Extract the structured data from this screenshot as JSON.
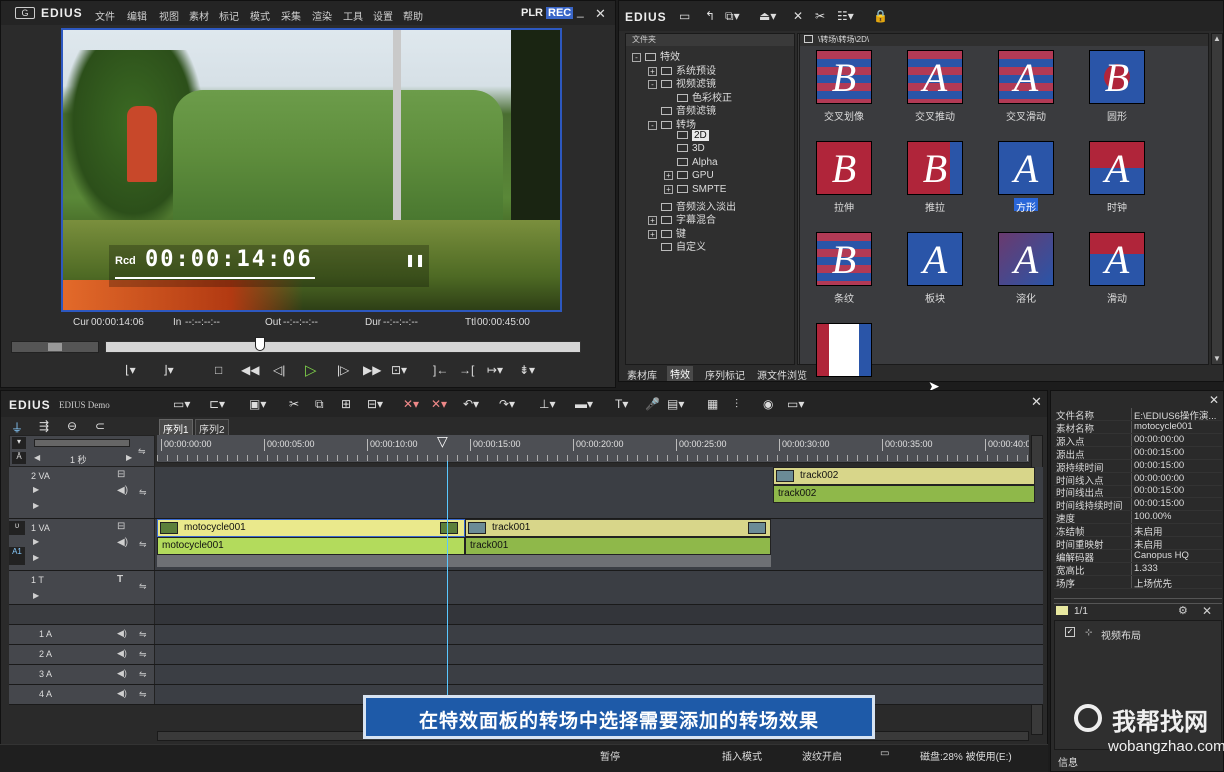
{
  "player": {
    "brand": "EDIUS",
    "menu": [
      "文件",
      "编辑",
      "视图",
      "素材",
      "标记",
      "模式",
      "采集",
      "渲染",
      "工具",
      "设置",
      "帮助"
    ],
    "plr": "PLR",
    "rec": "REC",
    "osd_label": "Rcd",
    "osd_timecode": "00:00:14:06",
    "cur_label": "Cur",
    "cur_value": "00:00:14:06",
    "in_label": "In",
    "in_value": "--:--:--:--",
    "out_label": "Out",
    "out_value": "--:--:--:--",
    "dur_label": "Dur",
    "dur_value": "--:--:--:--",
    "ttl_label": "Ttl",
    "ttl_value": "00:00:45:00",
    "scrub_position": 0.32
  },
  "effects": {
    "brand": "EDIUS",
    "tree_header": "文件夹",
    "path": "\\转场\\转场\\2D\\",
    "tree": [
      {
        "label": "特效",
        "level": 0,
        "expander": "-"
      },
      {
        "label": "系统预设",
        "level": 1,
        "expander": "+"
      },
      {
        "label": "视频滤镜",
        "level": 1,
        "expander": "-"
      },
      {
        "label": "色彩校正",
        "level": 2,
        "expander": ""
      },
      {
        "label": "音频滤镜",
        "level": 1,
        "expander": ""
      },
      {
        "label": "转场",
        "level": 1,
        "expander": "-"
      },
      {
        "label": "2D",
        "level": 2,
        "expander": "",
        "selected": true
      },
      {
        "label": "3D",
        "level": 2,
        "expander": ""
      },
      {
        "label": "Alpha",
        "level": 2,
        "expander": ""
      },
      {
        "label": "GPU",
        "level": 2,
        "expander": "+"
      },
      {
        "label": "SMPTE",
        "level": 2,
        "expander": "+"
      },
      {
        "label": "音频淡入淡出",
        "level": 1,
        "expander": ""
      },
      {
        "label": "字幕混合",
        "level": 1,
        "expander": "+"
      },
      {
        "label": "键",
        "level": 1,
        "expander": "+"
      },
      {
        "label": "自定义",
        "level": 1,
        "expander": ""
      }
    ],
    "items": [
      {
        "label": "交叉划像",
        "letter": "B",
        "style": "stripes"
      },
      {
        "label": "交叉推动",
        "letter": "A",
        "style": "stripes"
      },
      {
        "label": "交叉滑动",
        "letter": "A",
        "style": "stripes"
      },
      {
        "label": "圆形",
        "letter": "B",
        "style": "circle"
      },
      {
        "label": "拉伸",
        "letter": "B",
        "style": "red"
      },
      {
        "label": "推拉",
        "letter": "B",
        "style": "redblue"
      },
      {
        "label": "方形",
        "letter": "A",
        "style": "blue",
        "selected": true
      },
      {
        "label": "时钟",
        "letter": "A",
        "style": "clock"
      },
      {
        "label": "条纹",
        "letter": "B",
        "style": "stripes"
      },
      {
        "label": "板块",
        "letter": "A",
        "style": "blue"
      },
      {
        "label": "溶化",
        "letter": "A",
        "style": "dissolve"
      },
      {
        "label": "滑动",
        "letter": "A",
        "style": "slide"
      },
      {
        "label": "",
        "letter": "",
        "style": "flag"
      }
    ],
    "tabs": [
      "素材库",
      "特效",
      "序列标记",
      "源文件浏览"
    ],
    "active_tab": 1
  },
  "timeline": {
    "brand": "EDIUS",
    "edition": "EDIUS Demo",
    "sequences": [
      "序列1",
      "序列2"
    ],
    "scale_label": "1 秒",
    "ruler": [
      "00:00:00:00",
      "00:00:05:00",
      "00:00:10:00",
      "00:00:15:00",
      "00:00:20:00",
      "00:00:25:00",
      "00:00:30:00",
      "00:00:35:00",
      "00:00:40:0"
    ],
    "tracks": [
      {
        "name": "2 VA"
      },
      {
        "name": "1 VA"
      },
      {
        "name": "1 T"
      },
      {
        "name": "1 A"
      },
      {
        "name": "2 A"
      },
      {
        "name": "3 A"
      },
      {
        "name": "4 A"
      }
    ],
    "clips": {
      "track2_video": "track002",
      "track2_audio": "track002",
      "clip1_video": "motocycle001",
      "clip1_audio": "motocycle001",
      "clip2_video": "track001",
      "clip2_audio": "track001"
    },
    "subtitle": "在特效面板的转场中选择需要添加的转场效果"
  },
  "info": {
    "rows": [
      {
        "k": "文件名称",
        "v": "E:\\EDIUS6操作演..."
      },
      {
        "k": "素材名称",
        "v": "motocycle001"
      },
      {
        "k": "源入点",
        "v": "00:00:00:00"
      },
      {
        "k": "源出点",
        "v": "00:00:15:00"
      },
      {
        "k": "源持续时间",
        "v": "00:00:15:00"
      },
      {
        "k": "时间线入点",
        "v": "00:00:00:00"
      },
      {
        "k": "时间线出点",
        "v": "00:00:15:00"
      },
      {
        "k": "时间线持续时间",
        "v": "00:00:15:00"
      },
      {
        "k": "速度",
        "v": "100.00%"
      },
      {
        "k": "冻结帧",
        "v": "未启用"
      },
      {
        "k": "时间重映射",
        "v": "未启用"
      },
      {
        "k": "编解码器",
        "v": "Canopus HQ"
      },
      {
        "k": "宽高比",
        "v": "1.333"
      },
      {
        "k": "场序",
        "v": "上场优先"
      }
    ],
    "page": "1/1",
    "effect_item": "视频布局",
    "footer": "信息"
  },
  "status": {
    "pause": "暂停",
    "insert_mode": "插入模式",
    "ripple": "波纹开启",
    "disk": "磁盘:28% 被使用(E:)"
  },
  "watermark": {
    "site": "我帮找网",
    "url": "wobangzhao.com"
  }
}
